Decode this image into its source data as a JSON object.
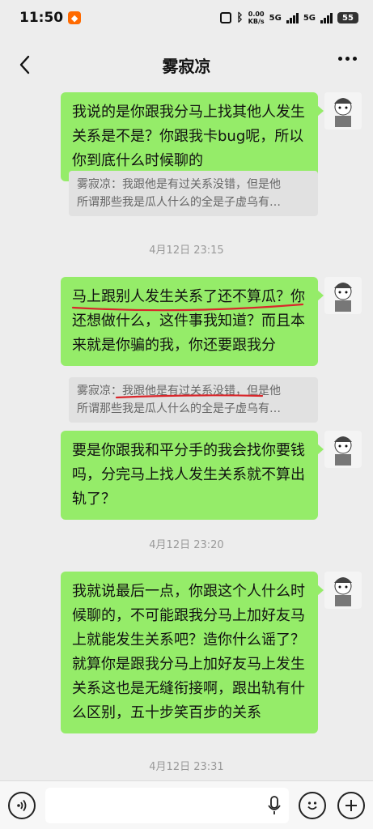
{
  "status": {
    "time": "11:50",
    "net_speed": "0.00",
    "net_unit": "KB/s",
    "sim1": "5G",
    "sim2": "5G",
    "battery": "55"
  },
  "header": {
    "title": "雾寂凉"
  },
  "messages": [
    {
      "text": "我说的是你跟我分马上找其他人发生关系是不是？你跟我卡bug呢，所以你到底什么时候聊的",
      "quote": [
        "雾寂凉：我跟他是有过关系没错，但是他",
        "所谓那些我是瓜人什么的全是子虚乌有…"
      ]
    },
    {
      "text": "马上跟别人发生关系了还不算瓜？你还想做什么，这件事我知道？而且本来就是你骗的我，你还要跟我分",
      "quote": [
        "雾寂凉：我跟他是有过关系没错，但是他",
        "所谓那些我是瓜人什么的全是子虚乌有…"
      ]
    },
    {
      "text": "要是你跟我和平分手的我会找你要钱吗，分完马上找人发生关系就不算出轨了？"
    },
    {
      "text": "我就说最后一点，你跟这个人什么时候聊的，不可能跟我分马上加好友马上就能发生关系吧？造你什么谣了？就算你是跟我分马上加好友马上发生关系这也是无缝衔接啊，跟出轨有什么区别，五十步笑百步的关系"
    }
  ],
  "timestamps": [
    "4月12日 23:15",
    "4月12日 23:20",
    "4月12日 23:31"
  ],
  "colors": {
    "bubble": "#95ec69",
    "annotation": "#d9262b"
  }
}
